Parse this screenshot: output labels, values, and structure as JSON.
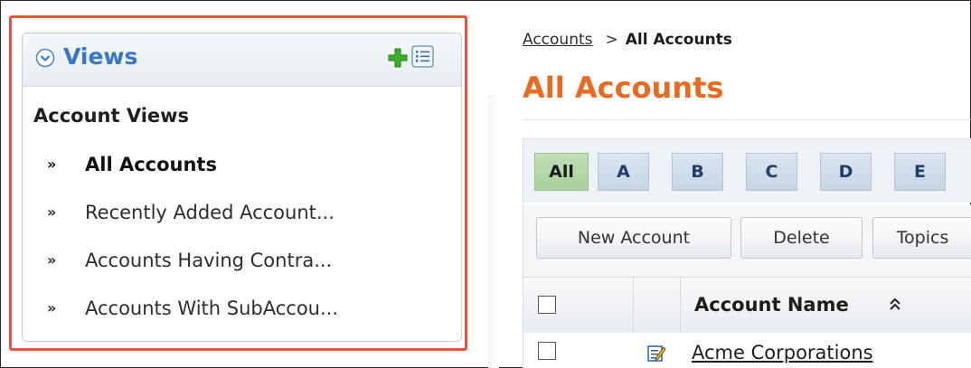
{
  "views_panel": {
    "title": "Views",
    "section_title": "Account Views",
    "items": [
      {
        "label": "All Accounts",
        "active": true
      },
      {
        "label": "Recently Added Account..."
      },
      {
        "label": "Accounts Having Contra..."
      },
      {
        "label": "Accounts With SubAccou..."
      }
    ],
    "arrow_glyph": "»",
    "icons": {
      "collapse": "chevron-down-circle-icon",
      "add": "green-plus-icon",
      "list": "list-view-icon"
    }
  },
  "breadcrumb": {
    "parent": "Accounts",
    "separator": ">",
    "current": "All Accounts"
  },
  "page_title": "All Accounts",
  "alpha_filter": {
    "buttons": [
      "All",
      "A",
      "B",
      "C",
      "D",
      "E"
    ],
    "selected": "All"
  },
  "toolbar": {
    "buttons": [
      "New Account",
      "Delete",
      "Topics"
    ]
  },
  "grid": {
    "columns": [
      {
        "label": "Account Name",
        "sort_icon": "sort-icon"
      }
    ],
    "rows": [
      {
        "account_name": "Acme Corporations"
      }
    ]
  },
  "colors": {
    "highlight": "#e8533e",
    "title_orange": "#e9691f",
    "views_blue": "#3677c8",
    "add_green": "#3fae29"
  }
}
